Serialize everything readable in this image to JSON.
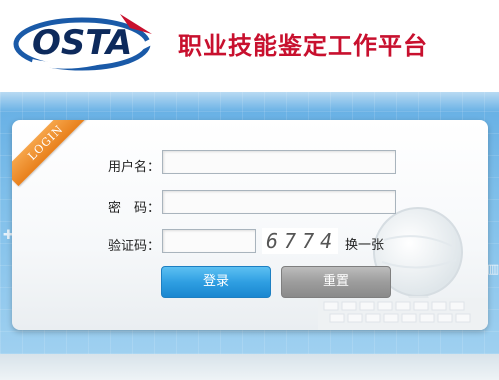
{
  "header": {
    "logo_text": "OSTA",
    "title": "职业技能鉴定工作平台"
  },
  "login": {
    "ribbon_text": "LOGIN",
    "username_label": "用户名：",
    "password_label": "密　码：",
    "captcha_label": "验证码：",
    "captcha_code": "6774",
    "refresh_label": "换一张",
    "login_button": "登录",
    "reset_button": "重置"
  },
  "colors": {
    "brand_red": "#c8102e",
    "brand_blue": "#1a5aa8",
    "login_button": "#2f9fe2",
    "reset_button": "#9d9d9d",
    "ribbon": "#e8801c"
  }
}
